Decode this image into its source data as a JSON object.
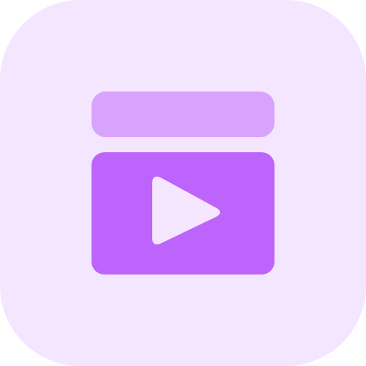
{
  "icon": {
    "name": "video-playlist-icon",
    "colors": {
      "background": "#F4E6FE",
      "top_bar": "#D8A4FB",
      "video_panel": "#BC64FB",
      "play_triangle": "#F4E6FE"
    }
  }
}
